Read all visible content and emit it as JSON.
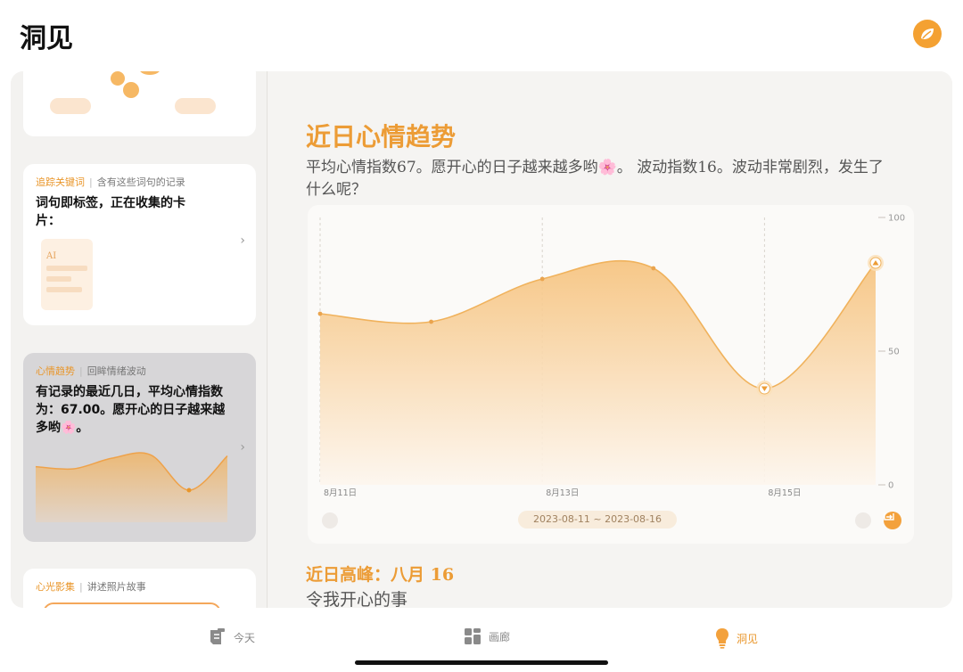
{
  "app": {
    "title": "洞见"
  },
  "sidebar": {
    "keywords_card": {
      "tag": "追踪关键词",
      "subtitle": "含有这些词句的记录",
      "text": "词句即标签，正在收集的卡片：",
      "doc_label": "AI"
    },
    "mood_card": {
      "tag": "心情趋势",
      "subtitle": "回眸情绪波动",
      "text": "有记录的最近几日，平均心情指数为：67.00。愿开心的日子越来越多哟🌸。",
      "mini_chart": {
        "type": "area",
        "values": [
          52,
          50,
          60,
          63,
          30,
          62
        ],
        "ylim": [
          0,
          100
        ]
      }
    },
    "photo_card": {
      "tag": "心光影集",
      "subtitle": "讲述照片故事"
    }
  },
  "content": {
    "title": "近日心情趋势",
    "summary": "平均心情指数67。愿开心的日子越来越多哟🌸。 波动指数16。波动非常剧烈，发生了什么呢？",
    "date_range": "2023-08-11 ~ 2023-08-16",
    "peak_title": "近日高峰：八月 16",
    "happy_title": "令我开心的事"
  },
  "chart_data": {
    "type": "area",
    "x": [
      "2023-08-11",
      "2023-08-12",
      "2023-08-13",
      "2023-08-14",
      "2023-08-15",
      "2023-08-16"
    ],
    "values": [
      64,
      61,
      77,
      81,
      36,
      83
    ],
    "x_tick_labels": [
      "8月11日",
      "8月13日",
      "8月15日"
    ],
    "x_tick_positions": [
      0,
      2,
      4
    ],
    "y_ticks": [
      "100",
      "50",
      "0"
    ],
    "ylim": [
      0,
      100
    ],
    "markers": {
      "max_index": 5,
      "min_index": 4
    },
    "colors": {
      "line": "#f0b25c",
      "fill_top": "#f6c27c",
      "fill_bottom": "#fdf6ee",
      "accent": "#ec9c36"
    }
  },
  "tabs": [
    {
      "label": "今天",
      "icon": "calendar-icon"
    },
    {
      "label": "画廊",
      "icon": "grid-icon"
    },
    {
      "label": "洞见",
      "icon": "lightbulb-icon"
    }
  ]
}
